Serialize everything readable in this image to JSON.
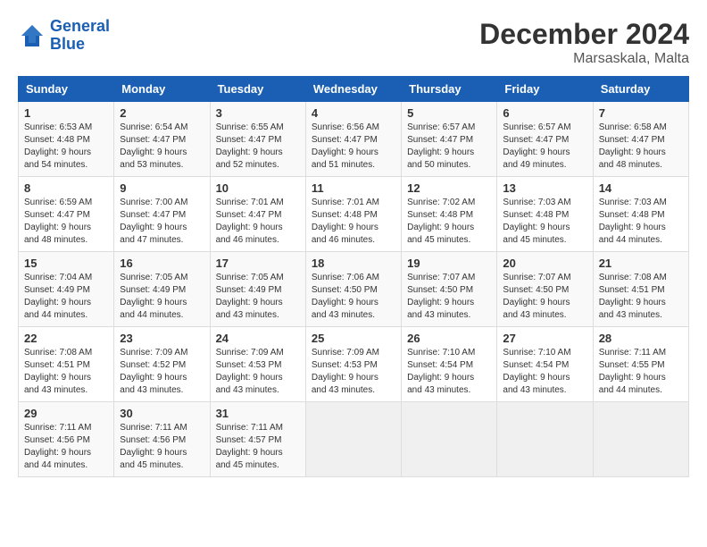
{
  "header": {
    "logo_line1": "General",
    "logo_line2": "Blue",
    "month_title": "December 2024",
    "location": "Marsaskala, Malta"
  },
  "weekdays": [
    "Sunday",
    "Monday",
    "Tuesday",
    "Wednesday",
    "Thursday",
    "Friday",
    "Saturday"
  ],
  "weeks": [
    [
      {
        "day": "1",
        "sunrise": "6:53 AM",
        "sunset": "4:48 PM",
        "daylight": "9 hours and 54 minutes."
      },
      {
        "day": "2",
        "sunrise": "6:54 AM",
        "sunset": "4:47 PM",
        "daylight": "9 hours and 53 minutes."
      },
      {
        "day": "3",
        "sunrise": "6:55 AM",
        "sunset": "4:47 PM",
        "daylight": "9 hours and 52 minutes."
      },
      {
        "day": "4",
        "sunrise": "6:56 AM",
        "sunset": "4:47 PM",
        "daylight": "9 hours and 51 minutes."
      },
      {
        "day": "5",
        "sunrise": "6:57 AM",
        "sunset": "4:47 PM",
        "daylight": "9 hours and 50 minutes."
      },
      {
        "day": "6",
        "sunrise": "6:57 AM",
        "sunset": "4:47 PM",
        "daylight": "9 hours and 49 minutes."
      },
      {
        "day": "7",
        "sunrise": "6:58 AM",
        "sunset": "4:47 PM",
        "daylight": "9 hours and 48 minutes."
      }
    ],
    [
      {
        "day": "8",
        "sunrise": "6:59 AM",
        "sunset": "4:47 PM",
        "daylight": "9 hours and 48 minutes."
      },
      {
        "day": "9",
        "sunrise": "7:00 AM",
        "sunset": "4:47 PM",
        "daylight": "9 hours and 47 minutes."
      },
      {
        "day": "10",
        "sunrise": "7:01 AM",
        "sunset": "4:47 PM",
        "daylight": "9 hours and 46 minutes."
      },
      {
        "day": "11",
        "sunrise": "7:01 AM",
        "sunset": "4:48 PM",
        "daylight": "9 hours and 46 minutes."
      },
      {
        "day": "12",
        "sunrise": "7:02 AM",
        "sunset": "4:48 PM",
        "daylight": "9 hours and 45 minutes."
      },
      {
        "day": "13",
        "sunrise": "7:03 AM",
        "sunset": "4:48 PM",
        "daylight": "9 hours and 45 minutes."
      },
      {
        "day": "14",
        "sunrise": "7:03 AM",
        "sunset": "4:48 PM",
        "daylight": "9 hours and 44 minutes."
      }
    ],
    [
      {
        "day": "15",
        "sunrise": "7:04 AM",
        "sunset": "4:49 PM",
        "daylight": "9 hours and 44 minutes."
      },
      {
        "day": "16",
        "sunrise": "7:05 AM",
        "sunset": "4:49 PM",
        "daylight": "9 hours and 44 minutes."
      },
      {
        "day": "17",
        "sunrise": "7:05 AM",
        "sunset": "4:49 PM",
        "daylight": "9 hours and 43 minutes."
      },
      {
        "day": "18",
        "sunrise": "7:06 AM",
        "sunset": "4:50 PM",
        "daylight": "9 hours and 43 minutes."
      },
      {
        "day": "19",
        "sunrise": "7:07 AM",
        "sunset": "4:50 PM",
        "daylight": "9 hours and 43 minutes."
      },
      {
        "day": "20",
        "sunrise": "7:07 AM",
        "sunset": "4:50 PM",
        "daylight": "9 hours and 43 minutes."
      },
      {
        "day": "21",
        "sunrise": "7:08 AM",
        "sunset": "4:51 PM",
        "daylight": "9 hours and 43 minutes."
      }
    ],
    [
      {
        "day": "22",
        "sunrise": "7:08 AM",
        "sunset": "4:51 PM",
        "daylight": "9 hours and 43 minutes."
      },
      {
        "day": "23",
        "sunrise": "7:09 AM",
        "sunset": "4:52 PM",
        "daylight": "9 hours and 43 minutes."
      },
      {
        "day": "24",
        "sunrise": "7:09 AM",
        "sunset": "4:53 PM",
        "daylight": "9 hours and 43 minutes."
      },
      {
        "day": "25",
        "sunrise": "7:09 AM",
        "sunset": "4:53 PM",
        "daylight": "9 hours and 43 minutes."
      },
      {
        "day": "26",
        "sunrise": "7:10 AM",
        "sunset": "4:54 PM",
        "daylight": "9 hours and 43 minutes."
      },
      {
        "day": "27",
        "sunrise": "7:10 AM",
        "sunset": "4:54 PM",
        "daylight": "9 hours and 43 minutes."
      },
      {
        "day": "28",
        "sunrise": "7:11 AM",
        "sunset": "4:55 PM",
        "daylight": "9 hours and 44 minutes."
      }
    ],
    [
      {
        "day": "29",
        "sunrise": "7:11 AM",
        "sunset": "4:56 PM",
        "daylight": "9 hours and 44 minutes."
      },
      {
        "day": "30",
        "sunrise": "7:11 AM",
        "sunset": "4:56 PM",
        "daylight": "9 hours and 45 minutes."
      },
      {
        "day": "31",
        "sunrise": "7:11 AM",
        "sunset": "4:57 PM",
        "daylight": "9 hours and 45 minutes."
      },
      null,
      null,
      null,
      null
    ]
  ]
}
